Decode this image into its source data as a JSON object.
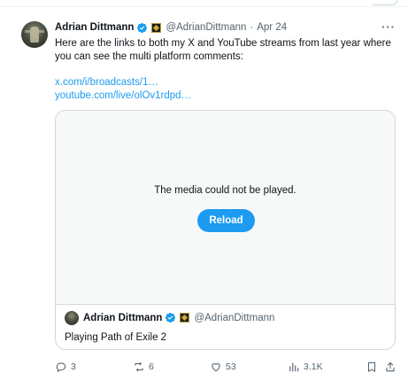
{
  "post": {
    "author_name": "Adrian Dittmann",
    "handle": "@AdrianDittmann",
    "separator": "·",
    "date": "Apr 24",
    "more_label": "···",
    "text": "Here are the links to both my X and YouTube streams from last year where you can see the multi platform comments:",
    "links": [
      "x.com/i/broadcasts/1…",
      "youtube.com/live/olOv1rdpd…"
    ]
  },
  "media": {
    "error_message": "The media could not be played.",
    "reload_label": "Reload"
  },
  "quote": {
    "author_name": "Adrian Dittmann",
    "handle": "@AdrianDittmann",
    "text": "Playing Path of Exile 2"
  },
  "actions": {
    "replies": "3",
    "reposts": "6",
    "likes": "53",
    "views": "3.1K"
  },
  "colors": {
    "accent": "#1d9bf0",
    "muted": "#536471",
    "border": "#cfd9de"
  }
}
